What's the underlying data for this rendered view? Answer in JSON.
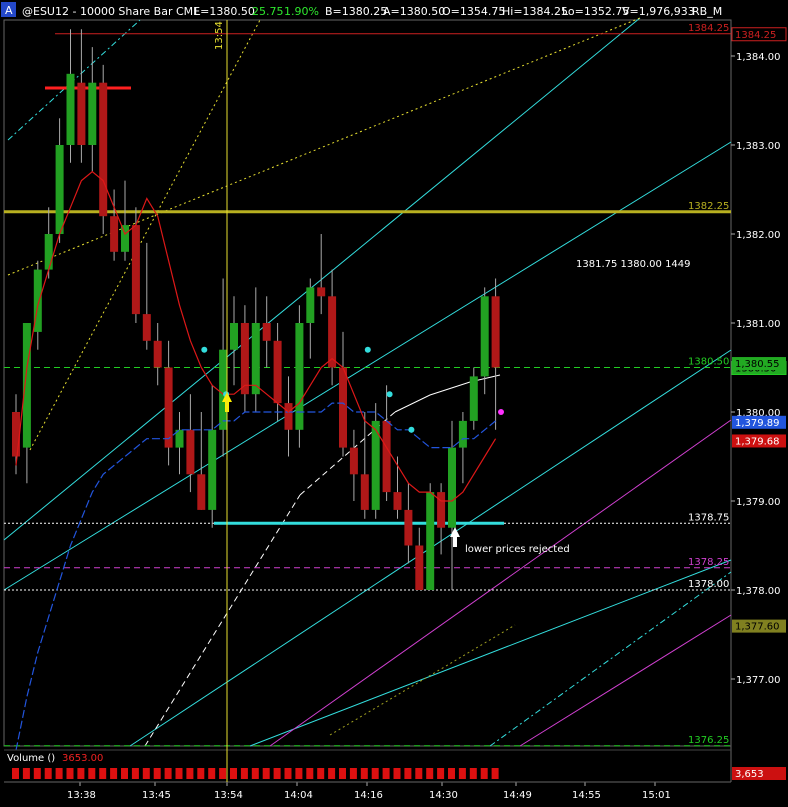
{
  "header": {
    "a_icon": "A",
    "symbol": "@ESU12 - 10000 Share Bar  CME",
    "last": "L=1380.50",
    "change": "25.75",
    "pct": "1.90%",
    "bid": "B=1380.25",
    "ask": "A=1380.50",
    "open": "O=1354.75",
    "hi": "Hi=1384.25",
    "lo": "Lo=1352.75",
    "vol": "V=1,976,933",
    "study": "RB_M"
  },
  "vline_label": "13:54",
  "volume": {
    "label": "Volume ()",
    "value": "3653.00",
    "badge": "3,653"
  },
  "annotations": {
    "quote": "1381.75  1380.00  1449",
    "rejected": "lower prices rejected"
  },
  "colors": {
    "bg": "#000000",
    "up": "#22a022",
    "down": "#b01818",
    "olive": "#b8b020",
    "cyan": "#33dddd",
    "magenta": "#d040d0",
    "green_dash": "#22cc22"
  },
  "chart_data": {
    "type": "candlestick",
    "title": "@ESU12 - 10000 Share Bar CME",
    "ylim": [
      1376.25,
      1384.6
    ],
    "y_ticks": [
      "1,384.00",
      "1,383.00",
      "1,382.00",
      "1,381.00",
      "1,380.00",
      "1,379.00",
      "1,378.00",
      "1,377.00"
    ],
    "x_ticks": [
      "13:38",
      "13:45",
      "13:54",
      "14:04",
      "14:16",
      "14:30",
      "14:49",
      "14:55",
      "15:01"
    ],
    "candles": [
      {
        "o": 1380.0,
        "h": 1380.2,
        "l": 1379.3,
        "c": 1379.5
      },
      {
        "o": 1379.6,
        "h": 1380.9,
        "l": 1379.2,
        "c": 1381.0
      },
      {
        "o": 1380.9,
        "h": 1381.7,
        "l": 1380.7,
        "c": 1381.6
      },
      {
        "o": 1381.6,
        "h": 1382.3,
        "l": 1381.5,
        "c": 1382.0
      },
      {
        "o": 1382.0,
        "h": 1383.3,
        "l": 1381.9,
        "c": 1383.0
      },
      {
        "o": 1383.0,
        "h": 1384.3,
        "l": 1382.8,
        "c": 1383.8
      },
      {
        "o": 1383.7,
        "h": 1384.3,
        "l": 1382.8,
        "c": 1383.0
      },
      {
        "o": 1383.0,
        "h": 1384.1,
        "l": 1382.7,
        "c": 1383.7
      },
      {
        "o": 1383.7,
        "h": 1383.9,
        "l": 1382.0,
        "c": 1382.2
      },
      {
        "o": 1382.2,
        "h": 1382.5,
        "l": 1381.7,
        "c": 1381.8
      },
      {
        "o": 1381.8,
        "h": 1382.6,
        "l": 1381.7,
        "c": 1382.1
      },
      {
        "o": 1382.1,
        "h": 1382.3,
        "l": 1381.0,
        "c": 1381.1
      },
      {
        "o": 1381.1,
        "h": 1381.9,
        "l": 1380.7,
        "c": 1380.8
      },
      {
        "o": 1380.8,
        "h": 1381.0,
        "l": 1380.3,
        "c": 1380.5
      },
      {
        "o": 1380.5,
        "h": 1380.8,
        "l": 1379.4,
        "c": 1379.6
      },
      {
        "o": 1379.6,
        "h": 1380.0,
        "l": 1379.3,
        "c": 1379.8
      },
      {
        "o": 1379.8,
        "h": 1380.2,
        "l": 1379.1,
        "c": 1379.3
      },
      {
        "o": 1379.3,
        "h": 1380.0,
        "l": 1378.9,
        "c": 1378.9
      },
      {
        "o": 1378.9,
        "h": 1380.3,
        "l": 1378.7,
        "c": 1379.8
      },
      {
        "o": 1379.8,
        "h": 1381.5,
        "l": 1379.5,
        "c": 1380.7
      },
      {
        "o": 1380.7,
        "h": 1381.3,
        "l": 1380.3,
        "c": 1381.0
      },
      {
        "o": 1381.0,
        "h": 1381.2,
        "l": 1380.0,
        "c": 1380.2
      },
      {
        "o": 1380.2,
        "h": 1381.4,
        "l": 1380.0,
        "c": 1381.0
      },
      {
        "o": 1381.0,
        "h": 1381.3,
        "l": 1380.5,
        "c": 1380.8
      },
      {
        "o": 1380.8,
        "h": 1381.0,
        "l": 1379.9,
        "c": 1380.1
      },
      {
        "o": 1380.1,
        "h": 1380.4,
        "l": 1379.5,
        "c": 1379.8
      },
      {
        "o": 1379.8,
        "h": 1381.2,
        "l": 1379.6,
        "c": 1381.0
      },
      {
        "o": 1381.0,
        "h": 1381.5,
        "l": 1380.6,
        "c": 1381.4
      },
      {
        "o": 1381.4,
        "h": 1382.0,
        "l": 1381.1,
        "c": 1381.3
      },
      {
        "o": 1381.3,
        "h": 1381.6,
        "l": 1380.3,
        "c": 1380.5
      },
      {
        "o": 1380.5,
        "h": 1380.9,
        "l": 1379.5,
        "c": 1379.6
      },
      {
        "o": 1379.6,
        "h": 1379.8,
        "l": 1379.0,
        "c": 1379.3
      },
      {
        "o": 1379.3,
        "h": 1380.0,
        "l": 1378.8,
        "c": 1378.9
      },
      {
        "o": 1378.9,
        "h": 1380.1,
        "l": 1378.8,
        "c": 1379.9
      },
      {
        "o": 1379.9,
        "h": 1380.3,
        "l": 1379.0,
        "c": 1379.1
      },
      {
        "o": 1379.1,
        "h": 1379.5,
        "l": 1378.8,
        "c": 1378.9
      },
      {
        "o": 1378.9,
        "h": 1379.2,
        "l": 1378.3,
        "c": 1378.5
      },
      {
        "o": 1378.5,
        "h": 1378.7,
        "l": 1378.0,
        "c": 1378.0
      },
      {
        "o": 1378.0,
        "h": 1379.2,
        "l": 1378.0,
        "c": 1379.1
      },
      {
        "o": 1379.1,
        "h": 1379.2,
        "l": 1378.4,
        "c": 1378.7
      },
      {
        "o": 1378.7,
        "h": 1379.9,
        "l": 1378.0,
        "c": 1379.6
      },
      {
        "o": 1379.6,
        "h": 1380.0,
        "l": 1379.2,
        "c": 1379.9
      },
      {
        "o": 1379.9,
        "h": 1380.5,
        "l": 1379.8,
        "c": 1380.4
      },
      {
        "o": 1380.4,
        "h": 1381.4,
        "l": 1380.2,
        "c": 1381.3
      },
      {
        "o": 1381.3,
        "h": 1381.5,
        "l": 1379.8,
        "c": 1380.5
      }
    ],
    "levels": [
      {
        "value": 1384.25,
        "label": "1384.25",
        "color": "#cc2020",
        "badge": true,
        "badge_text": "#cc2020",
        "style": "solid"
      },
      {
        "value": 1382.25,
        "label": "1382.25",
        "color": "#b8b020",
        "badge": false,
        "style": "thick"
      },
      {
        "value": 1380.5,
        "label": "1380.50",
        "color": "#22cc22",
        "badge": true,
        "badge_bg": "#22aa22",
        "badge_text": "#000000",
        "style": "dashed"
      },
      {
        "value": 1378.75,
        "label": "1378.75",
        "color": "#ffffff",
        "badge": false,
        "style": "dotted"
      },
      {
        "value": 1378.25,
        "label": "1378.25",
        "color": "#d040d0",
        "badge": false,
        "style": "dashed"
      },
      {
        "value": 1378.0,
        "label": "1378.00",
        "color": "#ffffff",
        "badge": false,
        "style": "dotted"
      },
      {
        "value": 1376.25,
        "label": "1376.25",
        "color": "#22cc22",
        "badge": false,
        "style": "dashed"
      }
    ],
    "price_badges": [
      {
        "value": 1380.55,
        "label": "1,380.55",
        "bg": "#22aa22",
        "fg": "#000000"
      },
      {
        "value": 1379.89,
        "label": "1,379.89",
        "bg": "#2255dd",
        "fg": "#ffffff"
      },
      {
        "value": 1379.68,
        "label": "1,379.68",
        "bg": "#cc1010",
        "fg": "#ffffff"
      },
      {
        "value": 1377.6,
        "label": "1,377.60",
        "bg": "#808020",
        "fg": "#000000"
      }
    ],
    "cyan_dots": [
      1380.7,
      1380.2,
      1380.7,
      1380.2,
      1379.8
    ],
    "magenta_dot": 1380.0
  }
}
